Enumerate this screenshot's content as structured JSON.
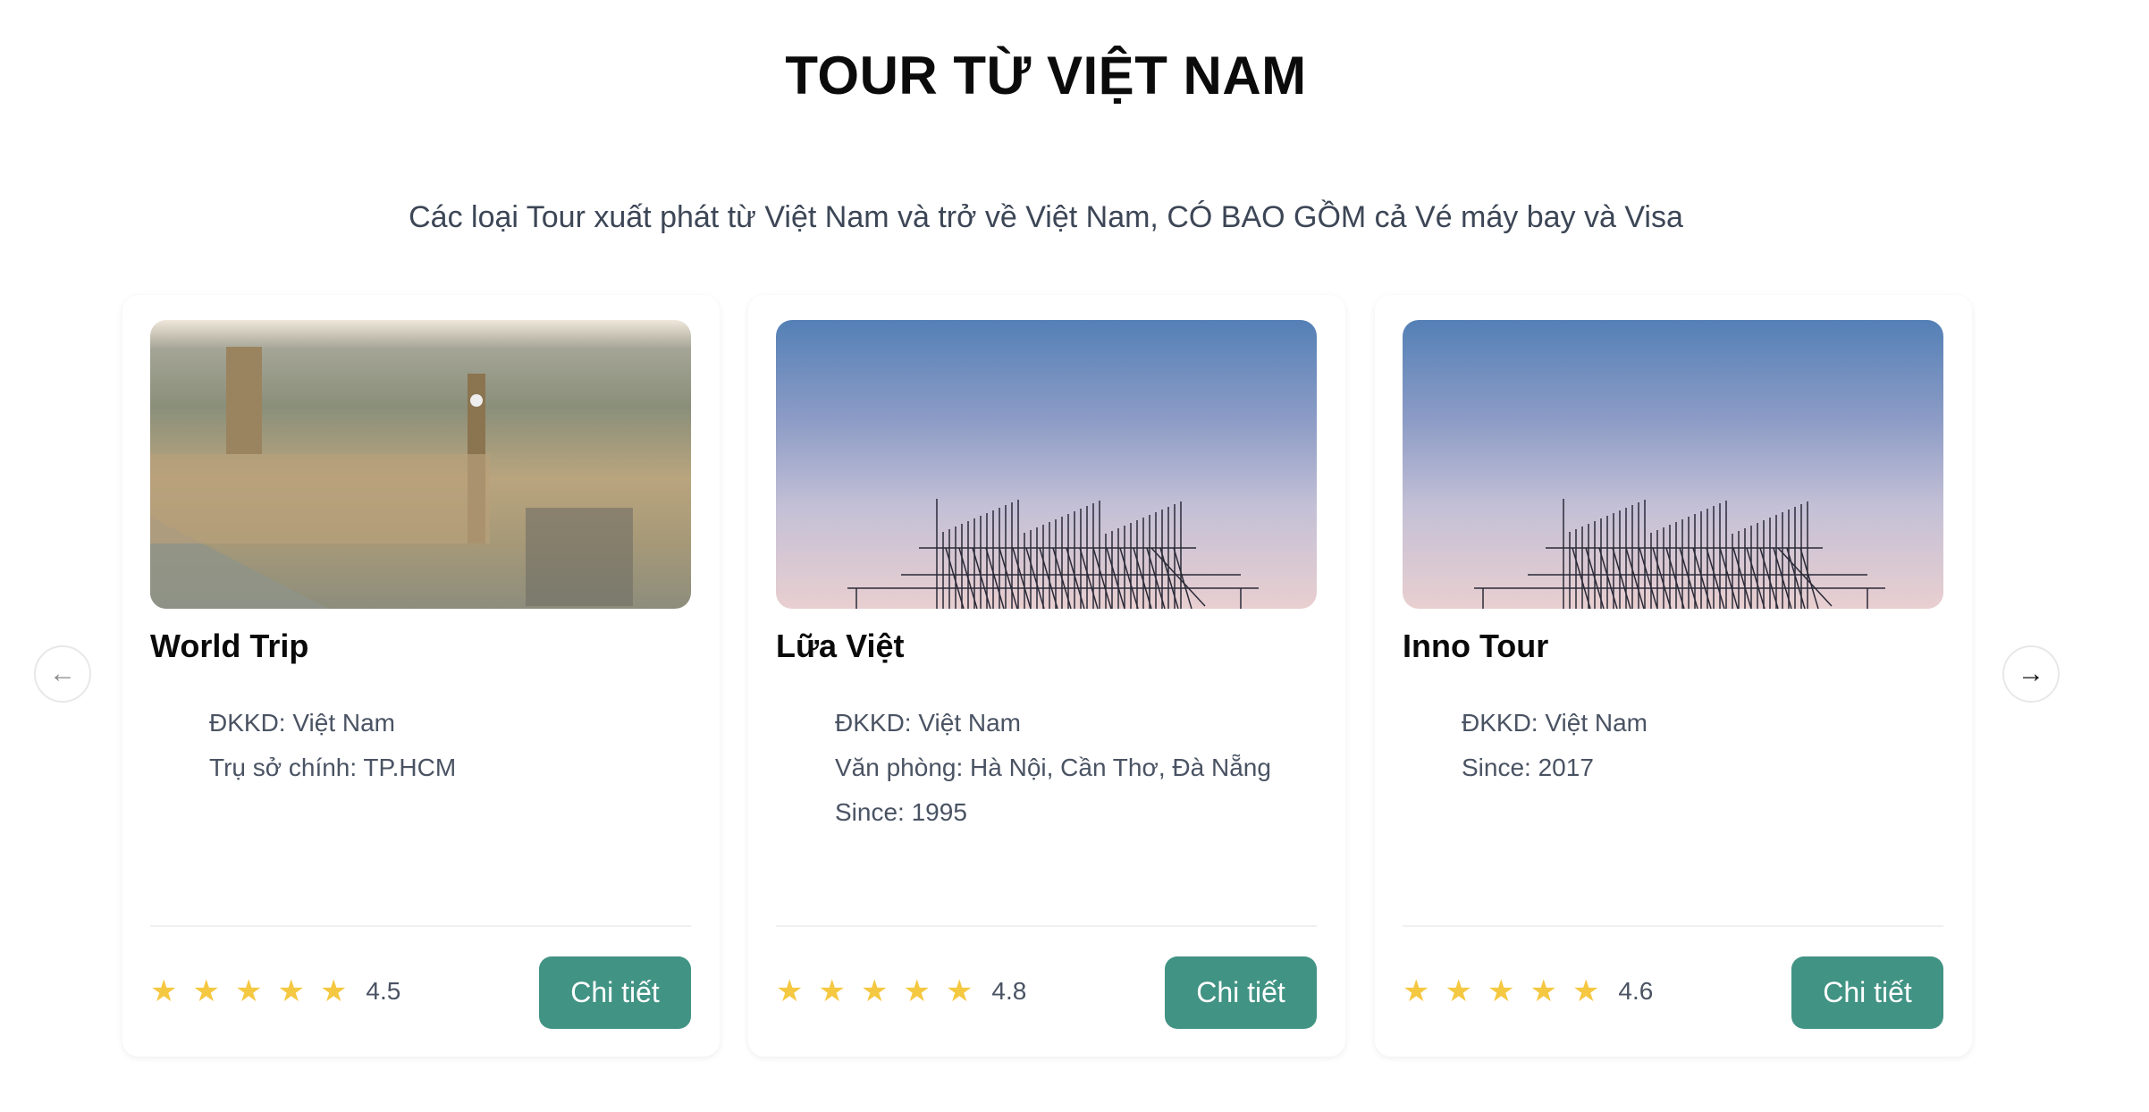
{
  "header": {
    "title": "TOUR TỪ VIỆT NAM",
    "subtitle": "Các loại Tour xuất phát từ Việt Nam và trở về Việt Nam, CÓ BAO GỒM cả Vé máy bay và Visa"
  },
  "cards": [
    {
      "name": "World Trip",
      "image": "london-parliament-photo",
      "info": [
        "ĐKKD: Việt Nam",
        "Trụ sở chính: TP.HCM"
      ],
      "rating": "4.5",
      "button": "Chi tiết"
    },
    {
      "name": "Lữa Việt",
      "image": "scaffolding-sky-photo",
      "info": [
        "ĐKKD: Việt Nam",
        "Văn phòng: Hà Nội, Cần Thơ, Đà Nẵng",
        "Since: 1995"
      ],
      "rating": "4.8",
      "button": "Chi tiết"
    },
    {
      "name": "Inno Tour",
      "image": "scaffolding-sky-photo",
      "info": [
        "ĐKKD: Việt Nam",
        "Since: 2017"
      ],
      "rating": "4.6",
      "button": "Chi tiết"
    }
  ],
  "nav": {
    "prev": "←",
    "next": "→"
  },
  "colors": {
    "accent": "#419384",
    "star": "#f5c842"
  }
}
